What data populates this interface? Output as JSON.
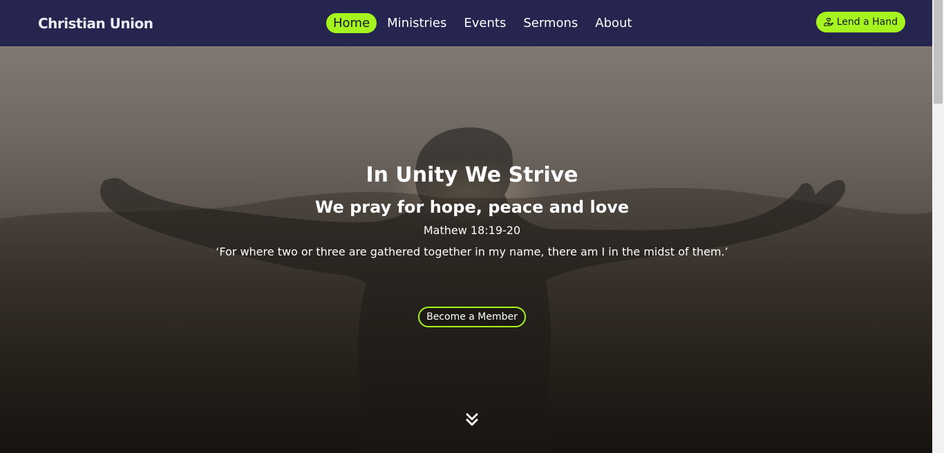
{
  "nav": {
    "brand": "Christian Union",
    "links": [
      "Home",
      "Ministries",
      "Events",
      "Sermons",
      "About"
    ],
    "active": "Home",
    "cta_label": "Lend a Hand",
    "cta_icon": "hand-heart-icon"
  },
  "hero": {
    "title": "In Unity We Strive",
    "subtitle": "We pray for hope, peace and love",
    "reference": "Mathew 18:19-20",
    "quote": "‘For where two or three are gathered together in my name, there am I in the midst of them.’",
    "button_label": "Become a Member",
    "scroll_icon": "chevrons-down-icon"
  },
  "colors": {
    "nav_bg": "#262550",
    "accent": "#a6f41f",
    "text_light": "#ffffff"
  }
}
